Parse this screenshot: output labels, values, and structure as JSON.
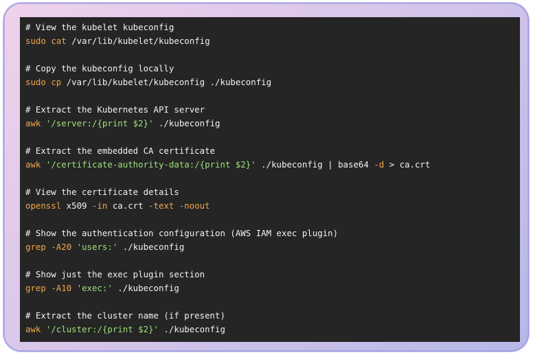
{
  "code": {
    "lines": [
      [
        {
          "t": "# View the kubelet kubeconfig",
          "c": "comment"
        }
      ],
      [
        {
          "t": "sudo",
          "c": "kw"
        },
        {
          "t": " ",
          "c": "plain"
        },
        {
          "t": "cat",
          "c": "kw"
        },
        {
          "t": " /var/lib/kubelet/kubeconfig",
          "c": "plain"
        }
      ],
      [],
      [
        {
          "t": "# Copy the kubeconfig locally",
          "c": "comment"
        }
      ],
      [
        {
          "t": "sudo",
          "c": "kw"
        },
        {
          "t": " ",
          "c": "plain"
        },
        {
          "t": "cp",
          "c": "kw"
        },
        {
          "t": " /var/lib/kubelet/kubeconfig ./kubeconfig",
          "c": "plain"
        }
      ],
      [],
      [
        {
          "t": "# Extract the Kubernetes API server",
          "c": "comment"
        }
      ],
      [
        {
          "t": "awk",
          "c": "kw"
        },
        {
          "t": " ",
          "c": "plain"
        },
        {
          "t": "'/server:/{print $2}'",
          "c": "str"
        },
        {
          "t": " ./kubeconfig",
          "c": "plain"
        }
      ],
      [],
      [
        {
          "t": "# Extract the embedded CA certificate",
          "c": "comment"
        }
      ],
      [
        {
          "t": "awk",
          "c": "kw"
        },
        {
          "t": " ",
          "c": "plain"
        },
        {
          "t": "'/certificate-authority-data:/{print $2}'",
          "c": "str"
        },
        {
          "t": " ./kubeconfig | base64 ",
          "c": "plain"
        },
        {
          "t": "-d",
          "c": "flag"
        },
        {
          "t": " > ca.crt",
          "c": "plain"
        }
      ],
      [],
      [
        {
          "t": "# View the certificate details",
          "c": "comment"
        }
      ],
      [
        {
          "t": "openssl",
          "c": "kw"
        },
        {
          "t": " x509 ",
          "c": "plain"
        },
        {
          "t": "-in",
          "c": "flag"
        },
        {
          "t": " ca.crt ",
          "c": "plain"
        },
        {
          "t": "-text",
          "c": "flag"
        },
        {
          "t": " ",
          "c": "plain"
        },
        {
          "t": "-noout",
          "c": "flag"
        }
      ],
      [],
      [
        {
          "t": "# Show the authentication configuration (AWS IAM exec plugin)",
          "c": "comment"
        }
      ],
      [
        {
          "t": "grep",
          "c": "kw"
        },
        {
          "t": " ",
          "c": "plain"
        },
        {
          "t": "-A20",
          "c": "flag"
        },
        {
          "t": " ",
          "c": "plain"
        },
        {
          "t": "'users:'",
          "c": "str"
        },
        {
          "t": " ./kubeconfig",
          "c": "plain"
        }
      ],
      [],
      [
        {
          "t": "# Show just the exec plugin section",
          "c": "comment"
        }
      ],
      [
        {
          "t": "grep",
          "c": "kw"
        },
        {
          "t": " ",
          "c": "plain"
        },
        {
          "t": "-A10",
          "c": "flag"
        },
        {
          "t": " ",
          "c": "plain"
        },
        {
          "t": "'exec:'",
          "c": "str"
        },
        {
          "t": " ./kubeconfig",
          "c": "plain"
        }
      ],
      [],
      [
        {
          "t": "# Extract the cluster name (if present)",
          "c": "comment"
        }
      ],
      [
        {
          "t": "awk",
          "c": "kw"
        },
        {
          "t": " ",
          "c": "plain"
        },
        {
          "t": "'/cluster:/{print $2}'",
          "c": "str"
        },
        {
          "t": " ./kubeconfig",
          "c": "plain"
        }
      ]
    ]
  },
  "colors": {
    "code_background": "#252525",
    "frame_gradient_start": "#efd2ea",
    "frame_gradient_end": "#b6b8e8",
    "keyword": "#f0a64a",
    "string": "#9ee07a",
    "text": "#f2f2f2"
  }
}
